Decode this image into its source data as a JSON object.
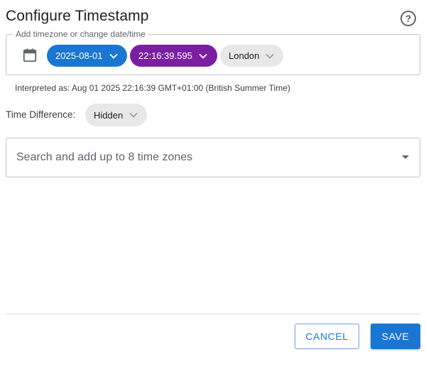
{
  "dialog": {
    "title": "Configure Timestamp",
    "help_icon": "question-circle-icon"
  },
  "datetime_group": {
    "legend": "Add timezone or change date/time",
    "calendar_icon": "calendar-icon",
    "date_chip": {
      "label": "2025-08-01",
      "color": "#1976d2"
    },
    "time_chip": {
      "label": "22:16:39.595",
      "color": "#7b1fa2"
    },
    "zone_chip": {
      "label": "London",
      "color": "#e8e8e8"
    }
  },
  "interpreted": "Interpreted as: Aug 01 2025 22:16:39 GMT+01:00 (British Summer Time)",
  "time_difference": {
    "label": "Time Difference:",
    "value": "Hidden"
  },
  "search": {
    "placeholder": "Search and add up to 8 time zones"
  },
  "actions": {
    "cancel_label": "CANCEL",
    "save_label": "SAVE",
    "accent": "#1976d2"
  }
}
